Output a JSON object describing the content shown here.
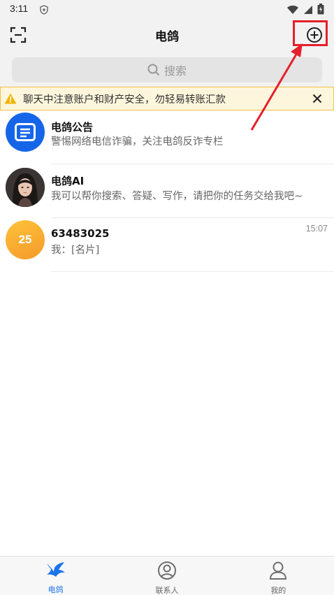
{
  "status_bar": {
    "time": "3:11"
  },
  "header": {
    "title": "电鸽"
  },
  "search": {
    "placeholder": "搜索"
  },
  "warning": {
    "text": "聊天中注意账户和财产安全，勿轻易转账汇款"
  },
  "chats": [
    {
      "name": "电鸽公告",
      "preview": "警惕网络电信诈骗，关注电鸽反诈专栏",
      "time": ""
    },
    {
      "name": "电鸽AI",
      "preview": "我可以帮你搜索、答疑、写作，请把你的任务交给我吧~",
      "time": ""
    },
    {
      "name": "63483025",
      "preview": "我：[名片]",
      "time": "15:07",
      "avatar_text": "25"
    }
  ],
  "nav": [
    {
      "label": "电鸽",
      "icon": "dove-icon"
    },
    {
      "label": "联系人",
      "icon": "contacts-icon"
    },
    {
      "label": "我的",
      "icon": "profile-icon"
    }
  ],
  "colors": {
    "accent": "#1a73e8",
    "warning_bg": "#fdf6dc",
    "warning_border": "#f2c24a",
    "annotation": "#e5202a"
  }
}
